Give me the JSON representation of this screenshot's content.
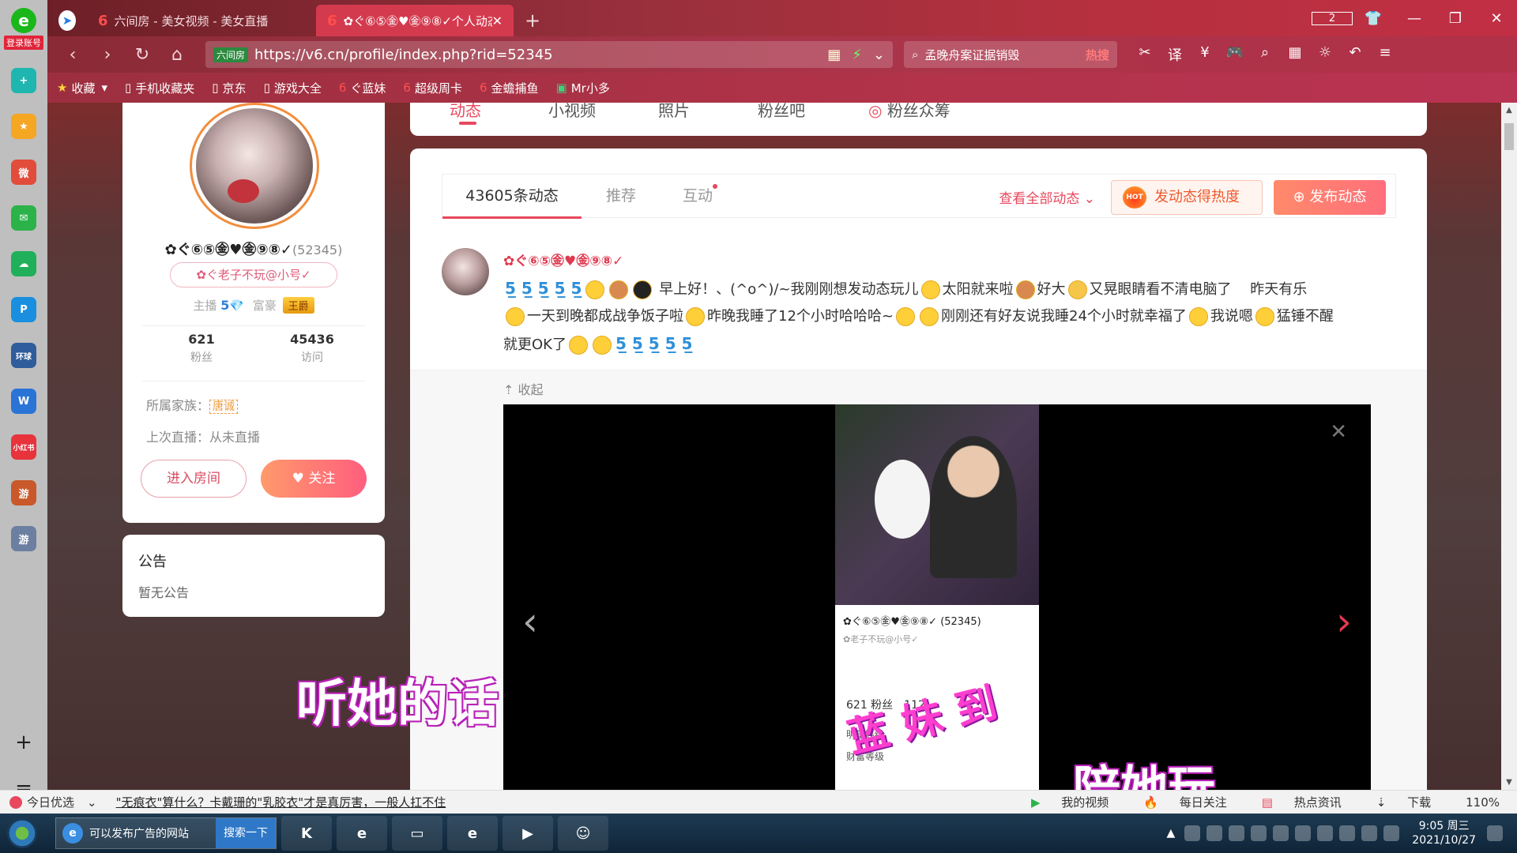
{
  "browser": {
    "sidebar_label": "登录账号",
    "sidebar_icons": [
      "plus-circle-icon",
      "star-icon",
      "weibo-icon",
      "mail-icon",
      "cloud-icon",
      "p-app-icon",
      "news-icon",
      "doc-icon",
      "xiaohongshu-icon",
      "game-icon",
      "game2-icon"
    ],
    "sidebar_icon_labels": [
      "+",
      "★",
      "微",
      "✉",
      "☁",
      "P",
      "环球",
      "W",
      "小红书",
      "游",
      "游"
    ],
    "tabs": [
      {
        "label": "六间房 - 美女视频 - 美女直播"
      },
      {
        "label": "✿ぐ⑥⑤㊎♥㊎⑨⑧✓个人动态"
      }
    ],
    "tab_count": "2",
    "url": "https://v6.cn/profile/index.php?rid=52345",
    "url_badge": "六间房",
    "search_text": "孟晚舟案证据销毁",
    "search_hot": "热搜",
    "bookmarks": [
      "收藏",
      "手机收藏夹",
      "京东",
      "游戏大全",
      "ぐ蓝妹",
      "超级周卡",
      "金蟾捕鱼",
      "Mr小多"
    ]
  },
  "top_tabs": [
    "动态",
    "小视频",
    "照片",
    "粉丝吧",
    "粉丝众筹"
  ],
  "profile": {
    "nickname": "✿ぐ⑥⑤㊎♥㊎⑨⑧✓",
    "rid": "(52345)",
    "sub_nick": "✿ぐ老子不玩@小号✓",
    "anchor_label": "主播",
    "anchor_level": "5",
    "rich_label": "富豪",
    "rich_badge": "王爵",
    "fans_count": "621",
    "fans_label": "粉丝",
    "visits_count": "45436",
    "visits_label": "访问",
    "family_label": "所属家族：",
    "family_tag": "唐诚",
    "last_live": "上次直播：从未直播",
    "enter_room": "进入房间",
    "follow": "关注"
  },
  "notice": {
    "title": "公告",
    "content": "暂无公告"
  },
  "feed": {
    "tabs": [
      "43605条动态",
      "推荐",
      "互动"
    ],
    "view_all": "查看全部动态",
    "hot_button": "发动态得热度",
    "hot_icon_text": "HOT",
    "post_button": "发布动态",
    "collapse": "收起"
  },
  "post": {
    "author": "✿ぐ⑥⑤㊎♥㊎⑨⑧✓",
    "line1_text": "早上好！、(^o^)/~我刚刚想发动态玩儿",
    "line1_b": "太阳就来啦",
    "line1_c": "好大",
    "line1_d": "又晃眼睛看不清电脑了　 昨天有乐",
    "line2_a": "一天到晚都成战争饭子啦",
    "line2_b": "昨晚我睡了12个小时哈哈哈~",
    "line2_c": "刚刚还有好友说我睡24个小时就幸福了",
    "line2_d": "我说嗯",
    "line2_e": "猛锤不醒",
    "line3": "就更OK了"
  },
  "phone_shot": {
    "name": "✿ぐ⑥⑤㊎♥㊎⑨⑧✓ (52345)",
    "sub": "✿老子不玩@小号✓",
    "counts": "621 粉丝　112",
    "levels": "明星等级",
    "rich": "财富等级"
  },
  "overlays": {
    "left": "听她的话",
    "right": "陪她玩",
    "mid": "蓝 妹 到"
  },
  "statusbar": {
    "todays_pick": "今日优选",
    "news": "\"无痕衣\"算什么？卡戴珊的\"乳胶衣\"才是真厉害，一般人扛不住",
    "my_video": "我的视频",
    "daily_follow": "每日关注",
    "hot_news": "热点资讯",
    "download": "下载",
    "zoom": "110%"
  },
  "taskbar": {
    "search_text": "可以发布广告的网站",
    "search_btn": "搜索一下",
    "time": "9:05 周三",
    "date": "2021/10/27"
  }
}
